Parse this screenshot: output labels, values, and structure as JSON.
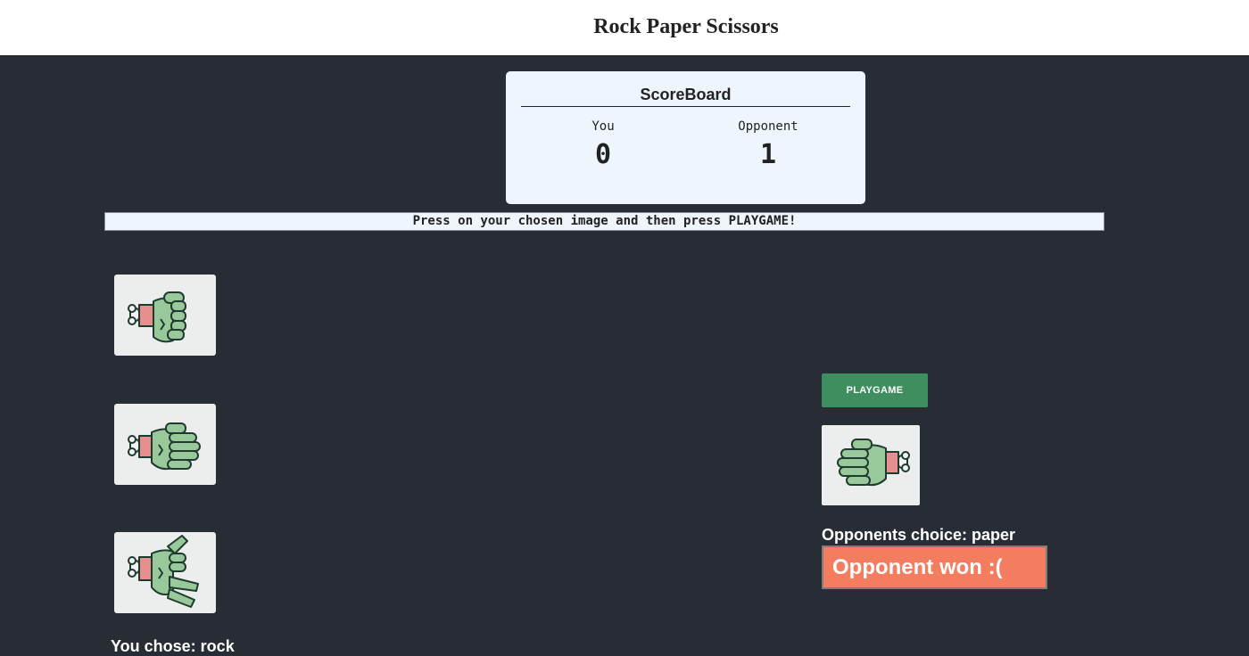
{
  "header": {
    "title": "Rock Paper Scissors"
  },
  "scoreboard": {
    "title": "ScoreBoard",
    "you_label": "You",
    "opponent_label": "Opponent",
    "you_score": "0",
    "opponent_score": "1"
  },
  "instructions": "Press on your chosen image and then press PLAYGAME!",
  "choices": [
    {
      "id": "rock",
      "icon": "zombie-hand-rock-icon"
    },
    {
      "id": "paper",
      "icon": "zombie-hand-paper-icon"
    },
    {
      "id": "scissors",
      "icon": "zombie-hand-scissors-icon"
    }
  ],
  "player": {
    "you_chose": "You chose: rock"
  },
  "play_button_label": "PLAYGAME",
  "opponent": {
    "choice_text": "Opponents choice: paper",
    "image_icon": "zombie-hand-paper-icon"
  },
  "result": {
    "text": "Opponent won :("
  },
  "colors": {
    "background": "#282c34",
    "panel": "#eef5fd",
    "play_button": "#3e8e5f",
    "result": "#f47c5f",
    "hand_skin": "#99c89b",
    "hand_outline": "#1f3b2f"
  }
}
